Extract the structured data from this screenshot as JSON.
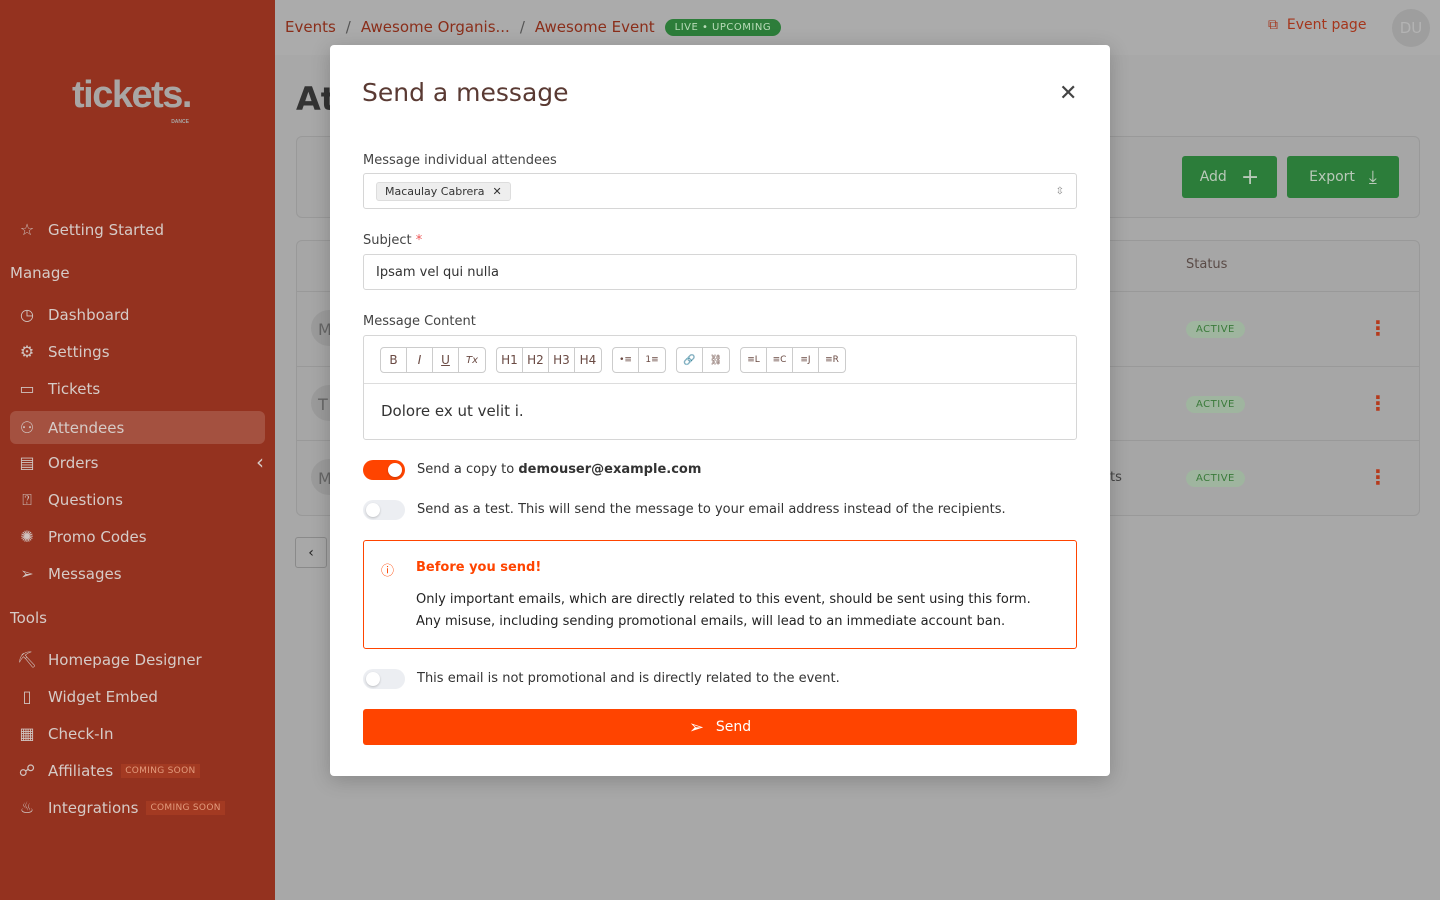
{
  "brand": {
    "logo": "tickets.",
    "logo_sub": "DANCE"
  },
  "sidebar": {
    "getting_started": "Getting Started",
    "manage_label": "Manage",
    "manage": [
      {
        "label": "Dashboard",
        "icon": "dashboard-icon"
      },
      {
        "label": "Settings",
        "icon": "gear-icon"
      },
      {
        "label": "Tickets",
        "icon": "ticket-icon"
      },
      {
        "label": "Attendees",
        "icon": "users-icon",
        "active": true
      },
      {
        "label": "Orders",
        "icon": "receipt-icon"
      },
      {
        "label": "Questions",
        "icon": "question-user-icon"
      },
      {
        "label": "Promo Codes",
        "icon": "discount-icon"
      },
      {
        "label": "Messages",
        "icon": "send-icon"
      }
    ],
    "tools_label": "Tools",
    "tools": [
      {
        "label": "Homepage Designer",
        "icon": "paint-icon"
      },
      {
        "label": "Widget Embed",
        "icon": "code-icon"
      },
      {
        "label": "Check-In",
        "icon": "qr-icon"
      },
      {
        "label": "Affiliates",
        "icon": "affiliate-icon",
        "badge": "COMING SOON"
      },
      {
        "label": "Integrations",
        "icon": "integrations-icon",
        "badge": "COMING SOON"
      }
    ]
  },
  "breadcrumb": {
    "items": [
      "Events",
      "Awesome Organis...",
      "Awesome Event"
    ],
    "status": "LIVE • UPCOMING"
  },
  "header": {
    "event_page": "Event page",
    "avatar": "DU"
  },
  "page": {
    "title": "At",
    "add": "Add",
    "export": "Export",
    "status_header": "Status",
    "rows": [
      {
        "avatar": "M",
        "status": "ACTIVE",
        "text": ""
      },
      {
        "avatar": "T",
        "status": "ACTIVE",
        "text": ""
      },
      {
        "avatar": "M",
        "status": "ACTIVE",
        "text": "ts"
      }
    ]
  },
  "modal": {
    "title": "Send a message",
    "attendees_label": "Message individual attendees",
    "selected_attendee": "Macaulay Cabrera",
    "subject_label": "Subject",
    "subject_value": "Ipsam vel qui nulla",
    "content_label": "Message Content",
    "toolbar": [
      [
        "B",
        "I",
        "U",
        "Tx"
      ],
      [
        "H1",
        "H2",
        "H3",
        "H4"
      ],
      [
        "•≡",
        "1≡"
      ],
      [
        "🔗",
        "⛓"
      ],
      [
        "≡L",
        "≡C",
        "≡J",
        "≡R"
      ]
    ],
    "content_value": "Dolore ex ut velit i.",
    "copy_prefix": "Send a copy to ",
    "copy_email": "demouser@example.com",
    "copy_on": true,
    "test_label": "Send as a test. This will send the message to your email address instead of the recipients.",
    "test_on": false,
    "warning_title": "Before you send!",
    "warning_line1": "Only important emails, which are directly related to this event, should be sent using this form.",
    "warning_line2": "Any misuse, including sending promotional emails, will lead to an immediate account ban.",
    "confirm_label": "This email is not promotional and is directly related to the event.",
    "confirm_on": false,
    "send": "Send"
  },
  "colors": {
    "accent": "#ff4400",
    "sidebar": "#94321f",
    "success": "#2c7d3a"
  }
}
